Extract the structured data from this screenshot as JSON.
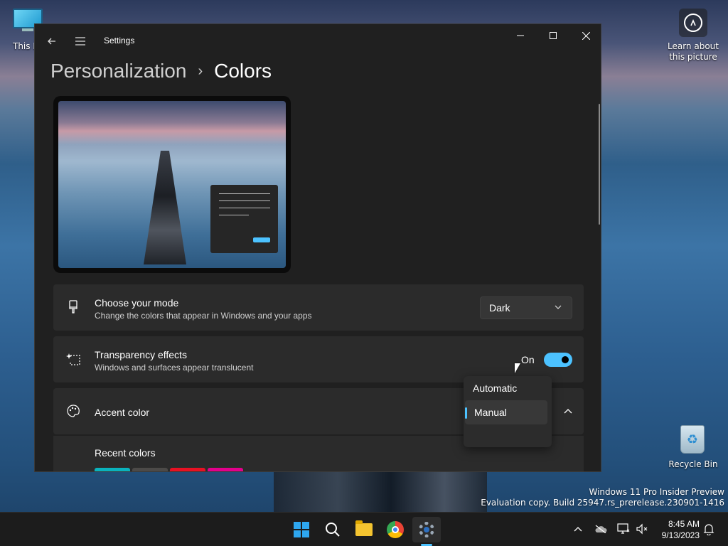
{
  "desktop": {
    "this_pc_label": "This P",
    "learn_label_line1": "Learn about",
    "learn_label_line2": "this picture",
    "recycle_label": "Recycle Bin",
    "watermark_line1": "Windows 11 Pro Insider Preview",
    "watermark_line2": "Evaluation copy. Build 25947.rs_prerelease.230901-1416"
  },
  "window": {
    "title": "Settings",
    "breadcrumb_parent": "Personalization",
    "breadcrumb_separator": "›",
    "breadcrumb_current": "Colors"
  },
  "mode": {
    "title": "Choose your mode",
    "subtitle": "Change the colors that appear in Windows and your apps",
    "value": "Dark"
  },
  "transparency": {
    "title": "Transparency effects",
    "subtitle": "Windows and surfaces appear translucent",
    "state_label": "On",
    "enabled": true
  },
  "accent": {
    "title": "Accent color",
    "options": [
      "Automatic",
      "Manual"
    ],
    "selected": "Manual"
  },
  "recent": {
    "title": "Recent colors",
    "colors": [
      "#0ab3bd",
      "#4c4a48",
      "#e81123",
      "#e3008c"
    ]
  },
  "taskbar": {
    "apps": [
      "start-icon",
      "search-icon",
      "file-explorer-icon",
      "chrome-icon",
      "settings-icon"
    ],
    "time": "8:45 AM",
    "date": "9/13/2023"
  },
  "colors": {
    "accent": "#4cc2ff",
    "window_bg": "#202020",
    "card_bg": "#2b2b2b"
  }
}
